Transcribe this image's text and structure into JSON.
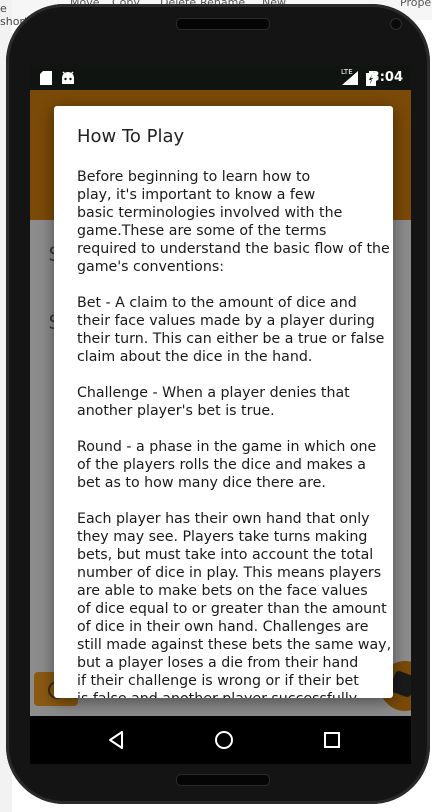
{
  "background_editor": {
    "top_texts": [
      "Move",
      "Copy",
      "Delete",
      "Rename",
      "New",
      "Prope"
    ],
    "left_text": "e shortcut"
  },
  "status_bar": {
    "time": "3:04",
    "network": "LTE",
    "left_icons": [
      "sd-card-icon",
      "android-icon"
    ]
  },
  "background_app": {
    "dollar_1": "$",
    "dollar_2": "$"
  },
  "dialog": {
    "title": "How To Play",
    "paragraphs": [
      {
        "lines": [
          "Before beginning to learn how to",
          "play, it's important to know a few",
          "basic terminologies involved with the",
          "game.These are some of the terms",
          "required to understand the basic flow of the",
          "game's conventions:"
        ]
      },
      {
        "lines": [
          "Bet - A claim to the amount of dice and",
          "their face values made by a player during",
          "their turn. This can either be a true or false",
          "claim about the dice in the hand."
        ]
      },
      {
        "lines": [
          "Challenge - When a player denies that",
          "another player's bet is true."
        ]
      },
      {
        "lines": [
          "Round - a phase in the game in which one",
          "of the players rolls the dice and makes a",
          "bet as to how many dice there are."
        ]
      },
      {
        "lines": [
          "Each player has their own hand that only",
          "they may see. Players take turns making",
          "bets, but must take into account the total",
          "number of dice in play. This means players",
          "are able to make bets on the face values",
          "of dice equal to or greater than the amount",
          "of dice in their own hand. Challenges are",
          "still made against these bets the same way,",
          "but a player loses a die from their hand",
          "if their challenge is wrong or if their bet",
          "is false and another player successfully"
        ]
      }
    ]
  },
  "nav_bar": {
    "buttons": [
      "back-icon",
      "home-icon",
      "recents-icon"
    ]
  }
}
